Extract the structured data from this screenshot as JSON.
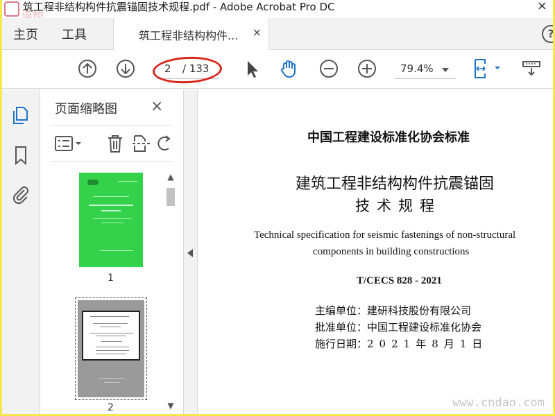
{
  "window": {
    "title": "筑工程非结构构件抗震锚固技术规程.pdf - Adobe Acrobat Pro DC",
    "close": "×",
    "watermark_logo_text": "道桥网"
  },
  "tabs": {
    "home": "主页",
    "tools": "工具",
    "document": "筑工程非结构构件...",
    "doc_close": "×",
    "help": "?"
  },
  "toolbar": {
    "current_page": "2",
    "total_pages": "/ 133",
    "zoom": "79.4%"
  },
  "panel": {
    "title": "页面缩略图",
    "close": "×",
    "thumbnails": [
      {
        "label": "1"
      },
      {
        "label": "2"
      }
    ]
  },
  "document": {
    "org": "中国工程建设标准化协会标准",
    "title_line1": "建筑工程非结构构件抗震锚固",
    "title_line2": "技术规程",
    "english_line1": "Technical specification for seismic fastenings of non-structural",
    "english_line2": "components in building constructions",
    "code": "T/CECS 828 - 2021",
    "rows": [
      {
        "label": "主编单位：",
        "value": "建研科技股份有限公司"
      },
      {
        "label": "批准单位：",
        "value": "中国工程建设标准化协会"
      },
      {
        "label": "施行日期：",
        "value": "2021年8月1日"
      }
    ]
  },
  "site_watermark": "www.cndao.com",
  "colors": {
    "accent_blue": "#1a73c8",
    "annotation_red": "#d9261c",
    "thumb_green": "#33d24a",
    "border_yellow": "#f4e84a"
  }
}
